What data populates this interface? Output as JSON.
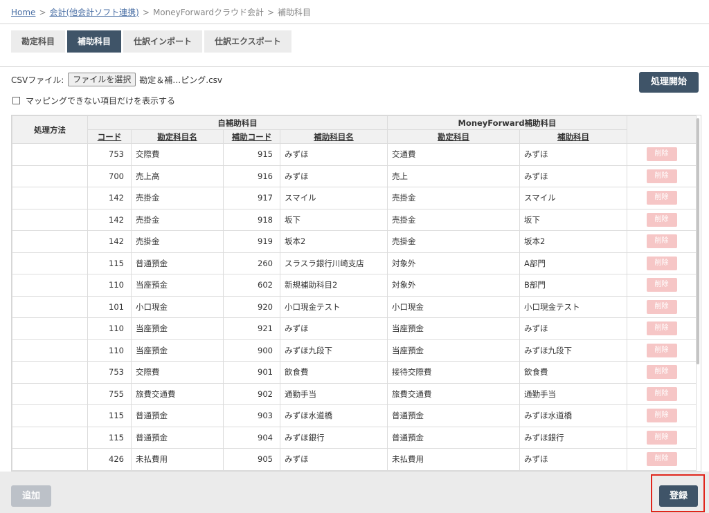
{
  "breadcrumb": {
    "home": "Home",
    "accounting": "会計(他会計ソフト連携)",
    "mf": "MoneyForwardクラウド会計",
    "current": "補助科目",
    "sep": ">"
  },
  "tabs": [
    "勘定科目",
    "補助科目",
    "仕訳インポート",
    "仕訳エクスポート"
  ],
  "active_tab": "補助科目",
  "csv": {
    "label": "CSVファイル:",
    "choose_button": "ファイルを選択",
    "file_name": "勘定＆補…ピング.csv"
  },
  "start_button": "処理開始",
  "filter_label": "マッピングできない項目だけを表示する",
  "table": {
    "header_method": "処理方法",
    "header_own": "自補助科目",
    "header_mf": "MoneyForward補助科目",
    "col_code": "コード",
    "col_account_name": "勘定科目名",
    "col_sub_code": "補助コード",
    "col_sub_name": "補助科目名",
    "col_mf_account": "勘定科目",
    "col_mf_sub": "補助科目",
    "delete_label": "削除",
    "rows": [
      {
        "code": "753",
        "name": "交際費",
        "sub_code": "915",
        "sub_name": "みずほ",
        "mf_account": "交通費",
        "mf_sub": "みずほ"
      },
      {
        "code": "700",
        "name": "売上高",
        "sub_code": "916",
        "sub_name": "みずほ",
        "mf_account": "売上",
        "mf_sub": "みずほ"
      },
      {
        "code": "142",
        "name": "売掛金",
        "sub_code": "917",
        "sub_name": "スマイル",
        "mf_account": "売掛金",
        "mf_sub": "スマイル"
      },
      {
        "code": "142",
        "name": "売掛金",
        "sub_code": "918",
        "sub_name": "坂下",
        "mf_account": "売掛金",
        "mf_sub": "坂下"
      },
      {
        "code": "142",
        "name": "売掛金",
        "sub_code": "919",
        "sub_name": "坂本2",
        "mf_account": "売掛金",
        "mf_sub": "坂本2"
      },
      {
        "code": "115",
        "name": "普通預金",
        "sub_code": "260",
        "sub_name": "スラスラ銀行川崎支店",
        "mf_account": "対象外",
        "mf_sub": "A部門"
      },
      {
        "code": "110",
        "name": "当座預金",
        "sub_code": "602",
        "sub_name": "新規補助科目2",
        "mf_account": "対象外",
        "mf_sub": "B部門"
      },
      {
        "code": "101",
        "name": "小口現金",
        "sub_code": "920",
        "sub_name": "小口現金テスト",
        "mf_account": "小口現金",
        "mf_sub": "小口現金テスト"
      },
      {
        "code": "110",
        "name": "当座預金",
        "sub_code": "921",
        "sub_name": "みずほ",
        "mf_account": "当座預金",
        "mf_sub": "みずほ"
      },
      {
        "code": "110",
        "name": "当座預金",
        "sub_code": "900",
        "sub_name": "みずほ九段下",
        "mf_account": "当座預金",
        "mf_sub": "みずほ九段下"
      },
      {
        "code": "753",
        "name": "交際費",
        "sub_code": "901",
        "sub_name": "飲食費",
        "mf_account": "接待交際費",
        "mf_sub": "飲食費"
      },
      {
        "code": "755",
        "name": "旅費交通費",
        "sub_code": "902",
        "sub_name": "通勤手当",
        "mf_account": "旅費交通費",
        "mf_sub": "通勤手当"
      },
      {
        "code": "115",
        "name": "普通預金",
        "sub_code": "903",
        "sub_name": "みずほ水道橋",
        "mf_account": "普通預金",
        "mf_sub": "みずほ水道橋"
      },
      {
        "code": "115",
        "name": "普通預金",
        "sub_code": "904",
        "sub_name": "みずほ銀行",
        "mf_account": "普通預金",
        "mf_sub": "みずほ銀行"
      },
      {
        "code": "426",
        "name": "未払費用",
        "sub_code": "905",
        "sub_name": "みずほ",
        "mf_account": "未払費用",
        "mf_sub": "みずほ"
      }
    ]
  },
  "footer": {
    "add_button": "追加",
    "register_button": "登録"
  },
  "colors": {
    "primary": "#3f5468",
    "delete": "#f6c6c6",
    "highlight": "#e0261c"
  }
}
